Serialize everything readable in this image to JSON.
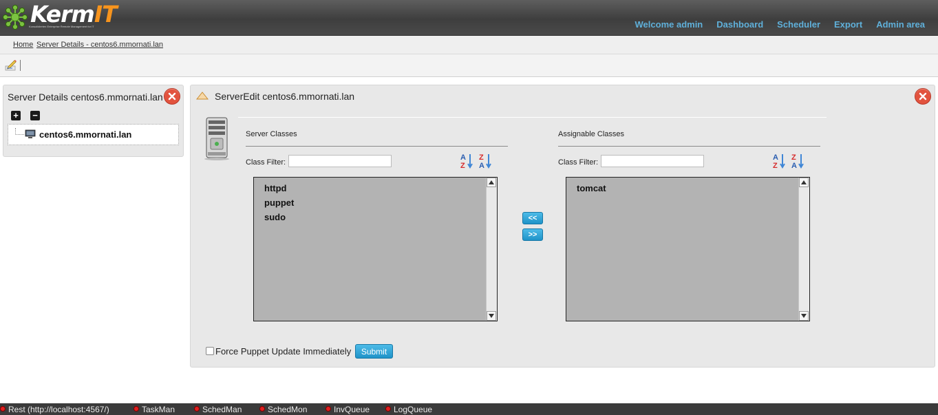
{
  "header": {
    "logo": {
      "main": "Kerm",
      "accent": "IT",
      "subtitle": "Konsolidierten Enterprise Remote Management for IT"
    },
    "nav": [
      "Welcome admin",
      "Dashboard",
      "Scheduler",
      "Export",
      "Admin area"
    ]
  },
  "breadcrumb": [
    "Home",
    "Server Details - centos6.mmornati.lan"
  ],
  "left_panel": {
    "title": "Server Details centos6.mmornati.lan",
    "expand_label": "+",
    "collapse_label": "−",
    "tree_node": "centos6.mmornati.lan"
  },
  "right_panel": {
    "title": "ServerEdit centos6.mmornati.lan",
    "server_classes": {
      "title": "Server Classes",
      "filter_label": "Class Filter:",
      "filter_value": "",
      "items": [
        "httpd",
        "puppet",
        "sudo"
      ]
    },
    "assignable_classes": {
      "title": "Assignable Classes",
      "filter_label": "Class Filter:",
      "filter_value": "",
      "items": [
        "tomcat"
      ]
    },
    "move_left_label": "<<",
    "move_right_label": ">>",
    "force_update_label": "Force Puppet Update Immediately",
    "force_update_checked": false,
    "submit_label": "Submit"
  },
  "status_bar": [
    "Rest (http://localhost:4567/)",
    "TaskMan",
    "SchedMan",
    "SchedMon",
    "InvQueue",
    "LogQueue"
  ],
  "colors": {
    "accent": "#f7941d",
    "nav_link": "#5fb0da",
    "button": "#1f93c8",
    "status_dot": "#e02020",
    "close": "#e2533e"
  }
}
